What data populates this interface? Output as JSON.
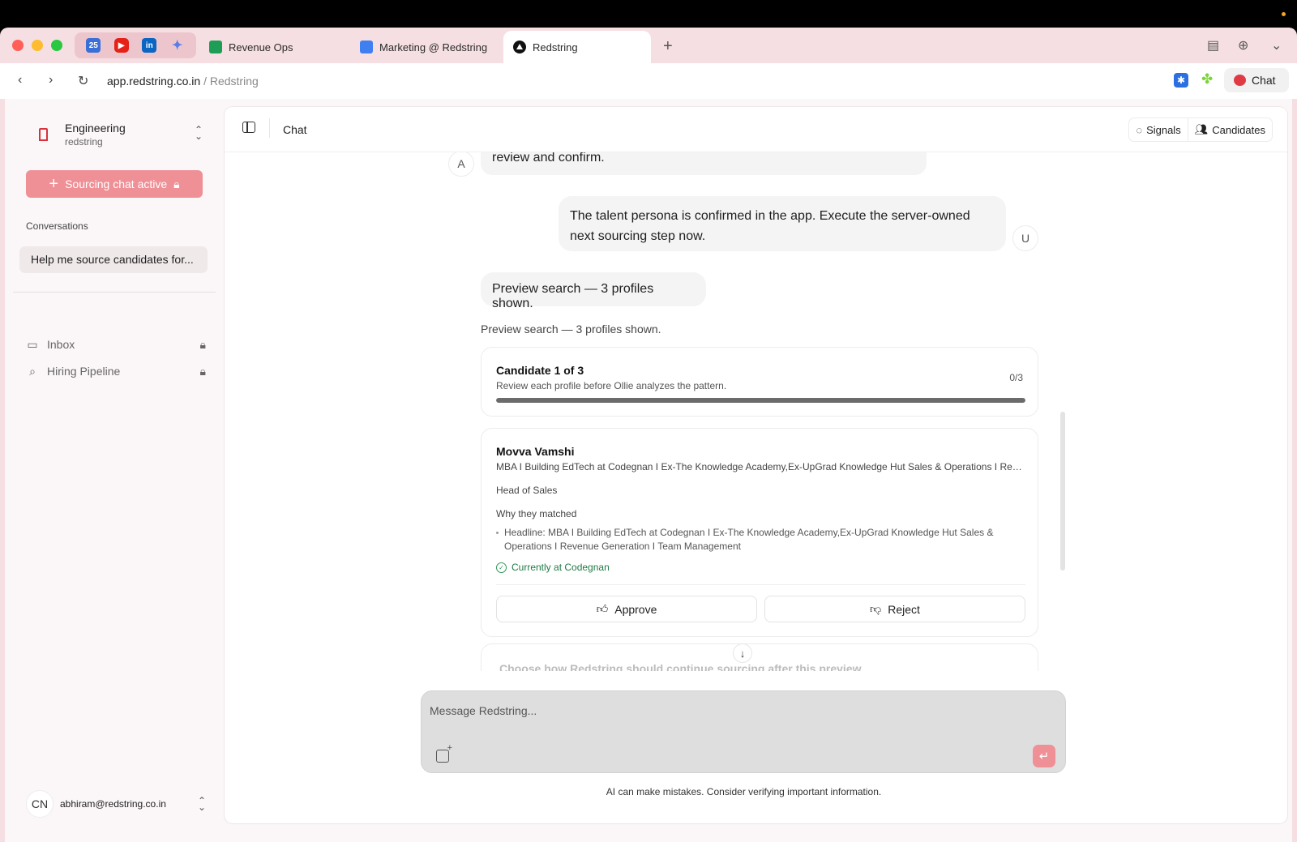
{
  "browser": {
    "pinned_tabs": [
      {
        "name": "calendar",
        "label": "25"
      },
      {
        "name": "youtube",
        "label": "▶"
      },
      {
        "name": "linkedin",
        "label": "in"
      },
      {
        "name": "gemini",
        "label": "✦"
      }
    ],
    "tabs": [
      {
        "title": "Revenue Ops",
        "icon": "sheets-icon"
      },
      {
        "title": "Marketing @ Redstring",
        "icon": "docs-icon"
      },
      {
        "title": "Redstring",
        "icon": "redstring-icon",
        "active": true
      }
    ],
    "new_tab": "+",
    "url_domain": "app.redstring.co.in",
    "url_path": " / Redstring",
    "chat_label": "Chat"
  },
  "sidebar": {
    "org_name": "Engineering",
    "org_sub": "redstring",
    "sourcing_button": "Sourcing chat active",
    "conversations_label": "Conversations",
    "conversation": "Help me source candidates for...",
    "nav": [
      {
        "label": "Inbox",
        "icon": "inbox-icon",
        "locked": true
      },
      {
        "label": "Hiring Pipeline",
        "icon": "pipeline-icon",
        "locked": true
      }
    ],
    "user_initials": "CN",
    "user_email": "abhiram@redstring.co.in"
  },
  "header": {
    "title": "Chat",
    "signals": "Signals",
    "candidates": "Candidates"
  },
  "conversation": {
    "assistant_avatar": "A",
    "user_avatar": "U",
    "assistant_fragment": "review and confirm.",
    "user_message": "The talent persona is confirmed in the app. Execute the server-owned next sourcing step now.",
    "preview_bubble": "Preview search — 3 profiles shown.",
    "preview_text": "Preview search — 3 profiles shown."
  },
  "progress": {
    "title": "Candidate 1 of 3",
    "subtitle": "Review each profile before Ollie analyzes the pattern.",
    "count": "0/3",
    "fraction": 0
  },
  "candidate": {
    "name": "Movva Vamshi",
    "headline": "MBA I Building EdTech at Codegnan I Ex-The Knowledge Academy,Ex-UpGrad Knowledge Hut Sales & Operations I Revenue Generation I Team Management",
    "role": "Head of Sales",
    "why_label": "Why they matched",
    "reason": "Headline: MBA I Building EdTech at Codegnan I Ex-The Knowledge Academy,Ex-UpGrad Knowledge Hut Sales & Operations I Revenue Generation I Team Management",
    "tag": "Currently at Codegnan",
    "approve": "Approve",
    "reject": "Reject"
  },
  "next_step": {
    "text": "Choose how Redstring should continue sourcing after this preview."
  },
  "composer": {
    "placeholder": "Message Redstring...",
    "disclaimer": "AI can make mistakes. Consider verifying important information."
  },
  "colors": {
    "accent": "#ef8f96",
    "chrome": "#f6dfe2",
    "success": "#1f7a45"
  }
}
